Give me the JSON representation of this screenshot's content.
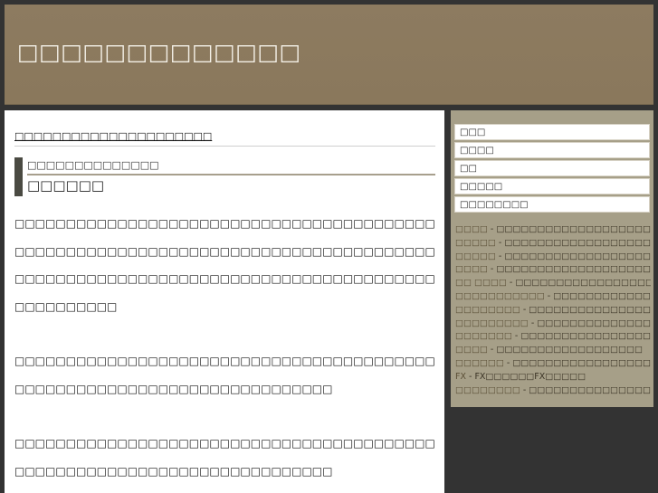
{
  "header": {
    "site_title": "□□□□□□□□□□□□□"
  },
  "main": {
    "breadcrumb": "□□□□□□□□□□□□□□□□□□□□□",
    "article": {
      "subtitle": "□□□□□□□□□□□□□□",
      "title": "□□□□□□"
    },
    "paragraphs": [
      "□□□□□□□□□□□□□□□□□□□□□□□□□□□□□□□□□□□□□□□□□□□□□□□□□□□□□□□□□□□□□□□□□□□□□□□□□□□□□□□□□□□□□□□□□□□□□□□□□□□□□□□□□□□□□□□□□□□□□□□□□□□□□□□□□□□□□",
      "□□□□□□□□□□□□□□□□□□□□□□□□□□□□□□□□□□□□□□□□□□□□□□□□□□□□□□□□□□□□□□□□□□□□□□□□",
      "□□□□□□□□□□□□□□□□□□□□□□□□□□□□□□□□□□□□□□□□□□□□□□□□□□□□□□□□□□□□□□□□□□□□□□□□"
    ]
  },
  "sidebar": {
    "nav": [
      {
        "label": "□□□"
      },
      {
        "label": "□□□□"
      },
      {
        "label": "□□"
      },
      {
        "label": "□□□□□"
      },
      {
        "label": "□□□□□□□□"
      }
    ],
    "links": [
      {
        "name": "□□□□",
        "sep": " - ",
        "desc": "□□□□□□□□□□□□□□□□□□□□□□□□□□□"
      },
      {
        "name": "□□□□□",
        "sep": " - ",
        "desc": "□□□□□□□□□□□□□□□□□□□"
      },
      {
        "name": "□□□□□",
        "sep": " - ",
        "desc": "□□□□□□□□□□□□□□□□□□□□□"
      },
      {
        "name": "□□□□",
        "sep": " - ",
        "desc": "□□□□□□□□□□□□□□□□□□□□□□□"
      },
      {
        "name": "□□ □□□□",
        "sep": " - ",
        "desc": "□□□□□□□□□□□□□□□□□□□□□□□□□□□"
      },
      {
        "name": "□□□□□□□□□□□",
        "sep": " - ",
        "desc": "□□□□□□□□□□□□□□□□□□□□□□□□□□"
      },
      {
        "name": "□□□□□□□□",
        "sep": " - ",
        "desc": "□□□□□□□□□□□□□□□□□□□□□□□□□"
      },
      {
        "name": "□□□□□□□□□",
        "sep": " - ",
        "desc": "□□□□□□□□□□□□□□□□□□□□□□□□"
      },
      {
        "name": "□□□□□□□",
        "sep": " - ",
        "desc": "□□□□□□□□□□□□□□□□□□□□□□□□□□"
      },
      {
        "name": "□□□□",
        "sep": " - ",
        "desc": "□□□□□□□□□□□□□□□□□□"
      },
      {
        "name": "□□□□□□",
        "sep": " - ",
        "desc": "□□□□□□□□□□□□□□□□□□□□□□□"
      },
      {
        "name": "FX",
        "sep": " - ",
        "desc": "FX□□□□□□FX□□□□□"
      },
      {
        "name": "□□□□□□□□",
        "sep": " - ",
        "desc": "□□□□□□□□□□□□□□□□□□□□□□□□□□□"
      }
    ]
  }
}
